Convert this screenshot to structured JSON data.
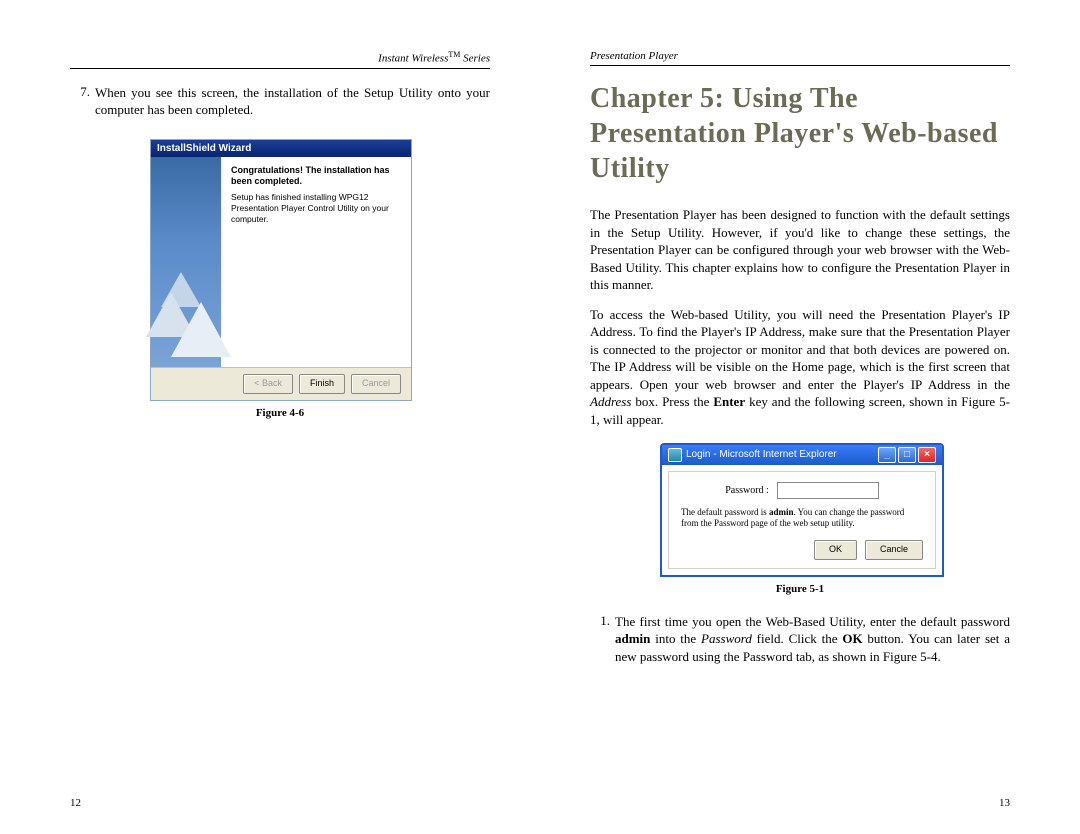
{
  "left": {
    "header": {
      "series": "Instant Wireless",
      "tm": "TM",
      "suffix": " Series"
    },
    "step7": {
      "num": "7.",
      "text": "When you see this screen, the installation of the Setup Utility onto your computer has been completed."
    },
    "fig46": {
      "title": "InstallShield Wizard",
      "congrats": "Congratulations! The installation has been completed.",
      "detail": "Setup has finished installing WPG12 Presentation Player Control Utility on your computer.",
      "back": "< Back",
      "finish": "Finish",
      "cancel": "Cancel",
      "caption": "Figure 4-6"
    },
    "pagenum": "12"
  },
  "right": {
    "header": "Presentation Player",
    "chapter": "Chapter 5: Using The Presentation Player's Web-based Utility",
    "para1": "The Presentation Player has been designed to function with the default settings in the Setup Utility. However, if you'd like to change these settings, the Presentation Player can be configured through your web browser with the Web-Based Utility. This chapter explains how to configure the Presentation Player in this manner.",
    "para2a": "To access the Web-based Utility, you will need the Presentation Player's IP Address. To find the Player's IP Address, make sure that the Presentation Player is connected to the projector or monitor and that both devices are powered on. The IP Address will be visible on the Home page, which is the first screen that appears. Open your web browser and enter the Player's IP Address in the ",
    "para2_address": "Address",
    "para2b": " box. Press the ",
    "para2_enter": "Enter",
    "para2c": " key and the following screen, shown in Figure 5-1, will appear.",
    "fig51": {
      "title": "Login - Microsoft Internet Explorer",
      "pwd_label": "Password :",
      "note_a": "The default password is ",
      "note_bold": "admin",
      "note_b": ". You can change the password from the Password page of the web setup utility.",
      "ok": "OK",
      "cancel": "Cancle",
      "caption": "Figure 5-1"
    },
    "step1": {
      "num": "1.",
      "a": "The first time you open the Web-Based Utility, enter the default password ",
      "admin": "admin",
      "b": " into the ",
      "pwd": "Password",
      "c": " field. Click the ",
      "ok": "OK",
      "d": " button.  You can later set a new password using the Password tab, as shown in Figure 5-4."
    },
    "pagenum": "13"
  }
}
